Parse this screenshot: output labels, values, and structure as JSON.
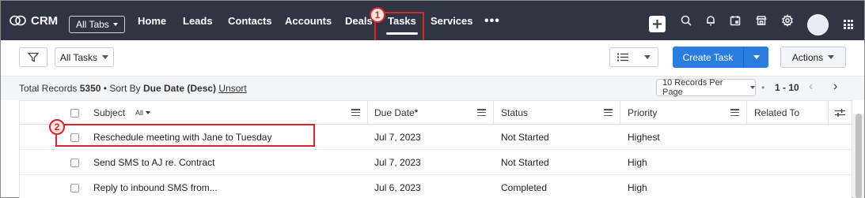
{
  "app": {
    "name": "CRM",
    "all_tabs_label": "All Tabs"
  },
  "nav": {
    "tabs": [
      {
        "label": "Home"
      },
      {
        "label": "Leads"
      },
      {
        "label": "Contacts"
      },
      {
        "label": "Accounts"
      },
      {
        "label": "Deals"
      },
      {
        "label": "Tasks",
        "active": true
      },
      {
        "label": "Services"
      }
    ],
    "more": "•••",
    "icons": [
      "plus-icon",
      "search-icon",
      "bell-icon",
      "calendar-icon",
      "store-icon",
      "gear-icon",
      "avatar",
      "apps-grid-icon"
    ]
  },
  "annotations": {
    "marker1": "1",
    "marker2": "2",
    "color": "#d9252b"
  },
  "toolbar": {
    "filter_view": "All Tasks",
    "create_task": "Create Task",
    "actions": "Actions"
  },
  "records": {
    "total_label": "Total Records",
    "total": "5350",
    "sort_label": "Sort By",
    "sort_value": "Due Date (Desc)",
    "unsort": "Unsort",
    "per_page": "10 Records Per Page",
    "range": "1 - 10"
  },
  "table": {
    "columns": {
      "subject": "Subject",
      "subject_filter": "All",
      "due_date": "Due Date",
      "due_date_marker": "*",
      "status": "Status",
      "priority": "Priority",
      "related_to": "Related To"
    },
    "rows": [
      {
        "subject": "Reschedule meeting with Jane to Tuesday",
        "due": "Jul 7, 2023",
        "status": "Not Started",
        "priority": "Highest"
      },
      {
        "subject": "Send SMS to AJ re. Contract",
        "due": "Jul 7, 2023",
        "status": "Not Started",
        "priority": "High"
      },
      {
        "subject": "Reply to inbound SMS from...",
        "due": "Jul 6, 2023",
        "status": "Completed",
        "priority": "High"
      }
    ]
  },
  "colors": {
    "nav_bg": "#2f3542",
    "primary_button": "#2a7ce0"
  }
}
